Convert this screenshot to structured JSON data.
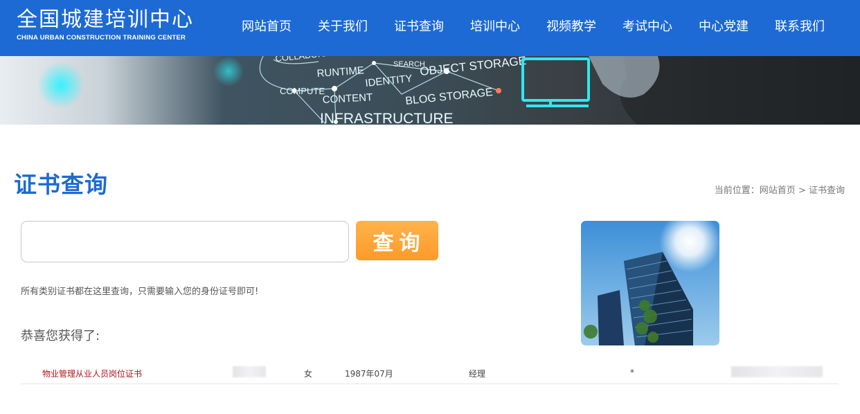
{
  "header": {
    "logo_cn": "全国城建培训中心",
    "logo_en": "CHINA URBAN CONSTRUCTION TRAINING CENTER",
    "nav": [
      "网站首页",
      "关于我们",
      "证书查询",
      "培训中心",
      "视频教学",
      "考试中心",
      "中心党建",
      "联系我们"
    ],
    "bg_color": "#1d6ad5"
  },
  "banner": {
    "words": [
      "COLLABORATION",
      "RUNTIME",
      "SEARCH",
      "OBJECT STORAGE",
      "IDENTITY",
      "COMPUTE",
      "CONTENT",
      "BLOG STORAGE",
      "INFRASTRUCTURE"
    ]
  },
  "page": {
    "title": "证书查询",
    "breadcrumb_prefix": "当前位置：",
    "breadcrumb_home": "网站首页",
    "breadcrumb_sep": ">",
    "breadcrumb_current": "证书查询"
  },
  "search": {
    "value": "",
    "placeholder": "",
    "button_label": "查询",
    "hint": "所有类别证书都在这里查询，只需要输入您的身份证号即可!"
  },
  "result": {
    "congrats": "恭喜您获得了:",
    "row": {
      "certificate": "物业管理从业人员岗位证书",
      "gender": "女",
      "birth": "1987年07月",
      "position": "经理",
      "mark": "*"
    }
  },
  "colors": {
    "accent": "#1d6ad5",
    "button": "#fd9a2a",
    "cert_link": "#b0141c"
  }
}
